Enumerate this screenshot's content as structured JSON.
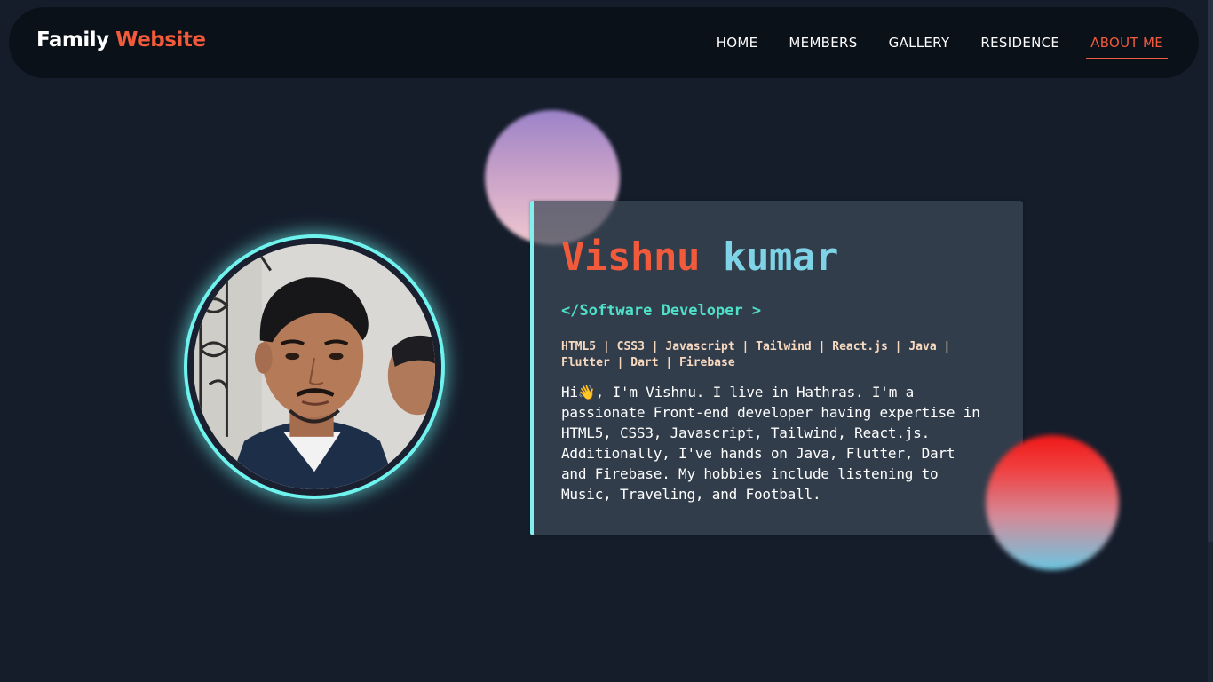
{
  "header": {
    "brand_part1": "Family",
    "brand_part2": "Website",
    "nav": [
      {
        "label": "HOME"
      },
      {
        "label": "MEMBERS"
      },
      {
        "label": "GALLERY"
      },
      {
        "label": "RESIDENCE"
      },
      {
        "label": "ABOUT ME",
        "active": true
      }
    ]
  },
  "profile": {
    "first_name": "Vishnu",
    "last_name": "kumar",
    "role": "</Software Developer >",
    "skills": "HTML5 | CSS3 | Javascript | Tailwind | React.js | Java | Flutter | Dart | Firebase",
    "bio": "Hi👋, I'm Vishnu. I live in Hathras. I'm a passionate Front-end developer having expertise in HTML5, CSS3, Javascript, Tailwind, React.js. Additionally, I've hands on Java, Flutter, Dart and Firebase. My hobbies include listening to Music, Traveling, and Football."
  },
  "colors": {
    "accent": "#f25a3c",
    "cyan": "#7fd3e6",
    "teal": "#4fe0c8",
    "background": "#151d2b",
    "navbar": "#0b1118"
  },
  "icons": {
    "avatar": "profile-photo"
  }
}
